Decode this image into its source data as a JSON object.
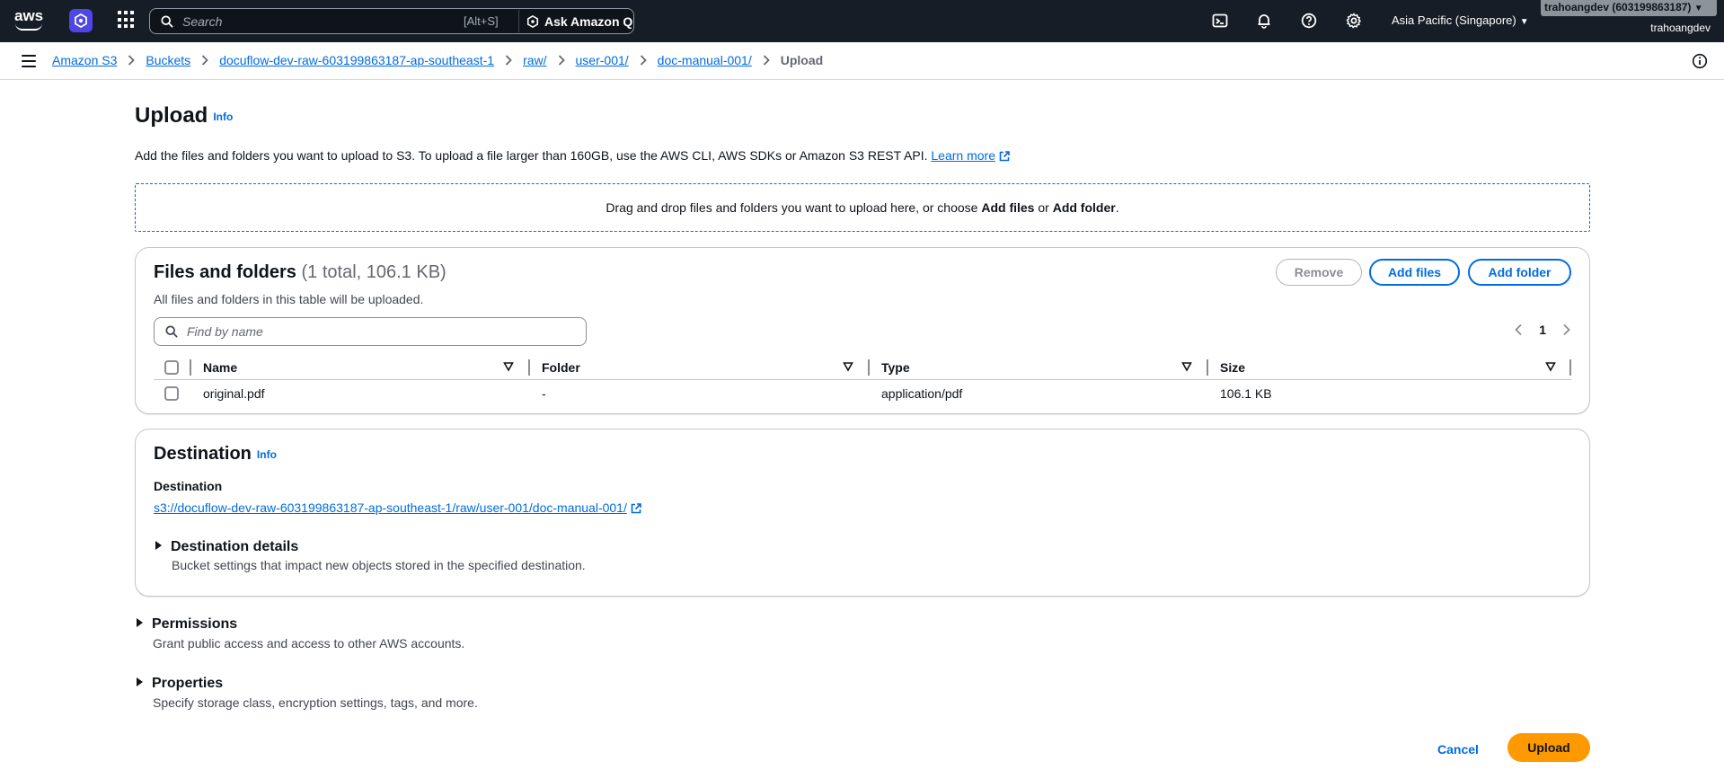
{
  "topnav": {
    "logo_text": "aws",
    "search_placeholder": "Search",
    "search_shortcut": "[Alt+S]",
    "ask_q_label": "Ask Amazon Q",
    "region": "Asia Pacific (Singapore)",
    "account_badge": "trahoangdev (603199863187)",
    "account_user": "trahoangdev",
    "colors": {
      "bg": "#161d26",
      "hex_btn": "#4f46e5"
    }
  },
  "breadcrumb": [
    {
      "label": "Amazon S3",
      "link": true
    },
    {
      "label": "Buckets",
      "link": true
    },
    {
      "label": "docuflow-dev-raw-603199863187-ap-southeast-1",
      "link": true
    },
    {
      "label": "raw/",
      "link": true
    },
    {
      "label": "user-001/",
      "link": true
    },
    {
      "label": "doc-manual-001/",
      "link": true
    },
    {
      "label": "Upload",
      "link": false
    }
  ],
  "page": {
    "title": "Upload",
    "info": "Info",
    "description": "Add the files and folders you want to upload to S3. To upload a file larger than 160GB, use the AWS CLI, AWS SDKs or Amazon S3 REST API.",
    "learn_more": "Learn more",
    "dropzone": {
      "prefix": "Drag and drop files and folders you want to upload here, or choose ",
      "add_files": "Add files",
      "or": " or ",
      "add_folder": "Add folder",
      "suffix": "."
    }
  },
  "files_panel": {
    "title": "Files and folders",
    "count": "(1 total, 106.1 KB)",
    "subtitle": "All files and folders in this table will be uploaded.",
    "remove_label": "Remove",
    "add_files_label": "Add files",
    "add_folder_label": "Add folder",
    "filter_placeholder": "Find by name",
    "page_number": "1",
    "columns": [
      "Name",
      "Folder",
      "Type",
      "Size"
    ],
    "rows": [
      {
        "name": "original.pdf",
        "folder": "-",
        "type": "application/pdf",
        "size": "106.1 KB"
      }
    ]
  },
  "destination_panel": {
    "title": "Destination",
    "info": "Info",
    "label": "Destination",
    "uri": "s3://docuflow-dev-raw-603199863187-ap-southeast-1/raw/user-001/doc-manual-001/",
    "details_title": "Destination details",
    "details_desc": "Bucket settings that impact new objects stored in the specified destination."
  },
  "permissions": {
    "title": "Permissions",
    "desc": "Grant public access and access to other AWS accounts."
  },
  "properties": {
    "title": "Properties",
    "desc": "Specify storage class, encryption settings, tags, and more."
  },
  "footer": {
    "cancel_label": "Cancel",
    "upload_label": "Upload",
    "upload_color": "#ff9900"
  },
  "colors": {
    "link": "#006ce0",
    "text": "#0f141a"
  }
}
